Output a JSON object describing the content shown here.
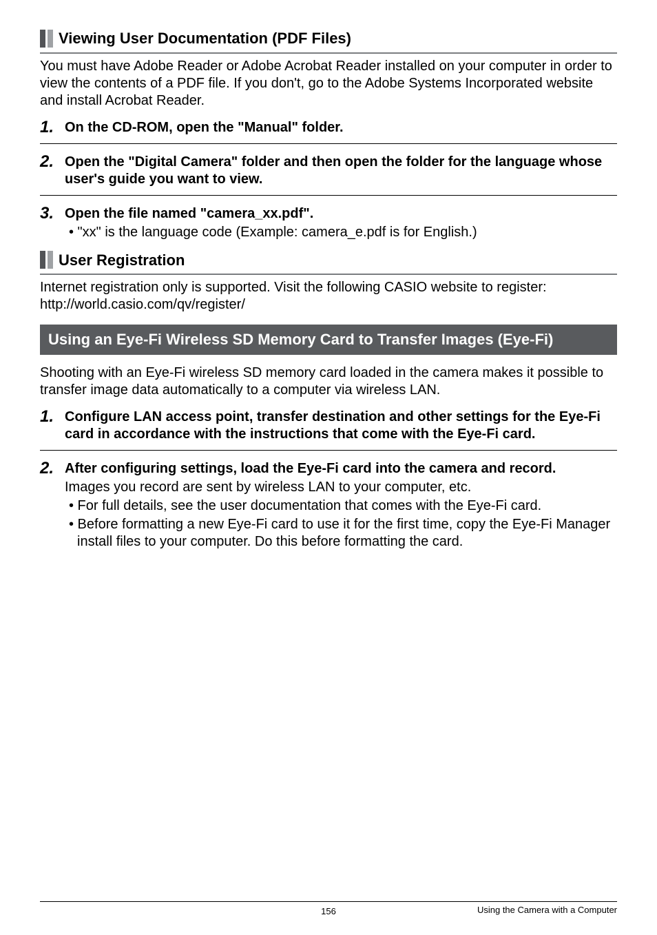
{
  "sec1": {
    "title": "Viewing User Documentation (PDF Files)",
    "intro": "You must have Adobe Reader or Adobe Acrobat Reader installed on your computer in order to view the contents of a PDF file. If you don't, go to the Adobe Systems Incorporated website and install Acrobat Reader.",
    "step1": {
      "num": "1.",
      "text": "On the CD-ROM, open the \"Manual\" folder."
    },
    "step2": {
      "num": "2.",
      "text": "Open the \"Digital Camera\" folder and then open the folder for the language whose user's guide you want to view."
    },
    "step3": {
      "num": "3.",
      "text": "Open the file named \"camera_xx.pdf\".",
      "bullet": "• \"xx\" is the language code (Example: camera_e.pdf is for English.)"
    }
  },
  "sec2": {
    "title": "User Registration",
    "body_line1": "Internet registration only is supported. Visit the following CASIO website to register:",
    "body_line2": "http://world.casio.com/qv/register/"
  },
  "sec3": {
    "title": "Using an Eye-Fi Wireless SD Memory Card to Transfer Images (Eye-Fi)",
    "intro": "Shooting with an Eye-Fi wireless SD memory card loaded in the camera makes it possible to transfer image data automatically to a computer via wireless LAN.",
    "step1": {
      "num": "1.",
      "text": "Configure LAN access point, transfer destination and other settings for the Eye-Fi card in accordance with the instructions that come with the Eye-Fi card."
    },
    "step2": {
      "num": "2.",
      "text": "After configuring settings, load the Eye-Fi card into the camera and record.",
      "desc": "Images you record are sent by wireless LAN to your computer, etc.",
      "b1": "• For full details, see the user documentation that comes with the Eye-Fi card.",
      "b2": "• Before formatting a new Eye-Fi card to use it for the first time, copy the Eye-Fi Manager install files to your computer. Do this before formatting the card."
    }
  },
  "footer": {
    "page": "156",
    "section": "Using the Camera with a Computer"
  }
}
